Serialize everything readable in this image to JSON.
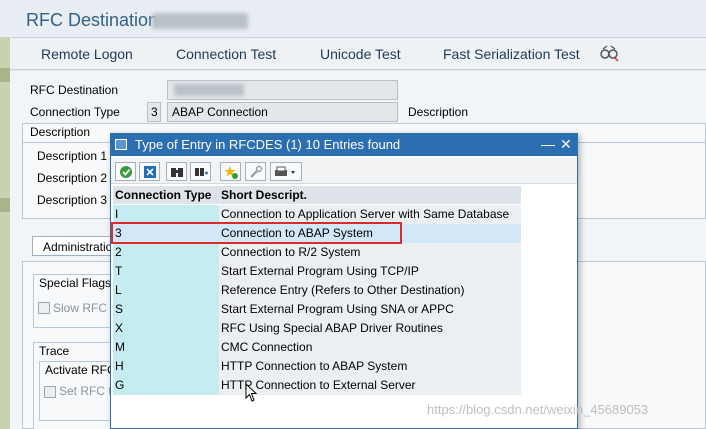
{
  "window": {
    "title": "RFC Destination"
  },
  "toolbar": {
    "buttons": [
      "Remote Logon",
      "Connection Test",
      "Unicode Test",
      "Fast Serialization Test"
    ],
    "glasses_icon": "glasses-icon"
  },
  "form": {
    "rfc_destination_label": "RFC Destination",
    "connection_type_label": "Connection Type",
    "connection_type_code": "3",
    "connection_type_text": "ABAP Connection",
    "description_right_label": "Description",
    "description_group": "Description",
    "description_fields": [
      "Description 1",
      "Description 2",
      "Description 3"
    ],
    "admin_tab": "Administratio",
    "special_flags": "Special Flags",
    "slow_rfc": "Slow RFC c",
    "trace": "Trace",
    "activate_rfc": "Activate RFC",
    "set_rfc": "Set RFC t"
  },
  "popup": {
    "title": "Type of Entry in RFCDES (1)   10 Entries found",
    "columns": [
      "Connection Type",
      "Short Descript."
    ],
    "rows": [
      {
        "type": "I",
        "desc": "Connection to Application Server with Same Database"
      },
      {
        "type": "3",
        "desc": "Connection to ABAP System"
      },
      {
        "type": "2",
        "desc": "Connection to R/2 System"
      },
      {
        "type": "T",
        "desc": "Start External Program Using TCP/IP"
      },
      {
        "type": "L",
        "desc": "Reference Entry (Refers to Other Destination)"
      },
      {
        "type": "S",
        "desc": "Start External Program Using SNA or APPC"
      },
      {
        "type": "X",
        "desc": "RFC Using Special ABAP Driver Routines"
      },
      {
        "type": "M",
        "desc": "CMC Connection"
      },
      {
        "type": "H",
        "desc": "HTTP Connection to ABAP System"
      },
      {
        "type": "G",
        "desc": "HTTP Connection to External Server"
      }
    ],
    "selected_index": 1
  },
  "watermark": "https://blog.csdn.net/weixin_45689053",
  "colors": {
    "popup_title": "#2c6fb0",
    "type_column": "#c5ecf1",
    "highlight": "#d92b2b"
  }
}
